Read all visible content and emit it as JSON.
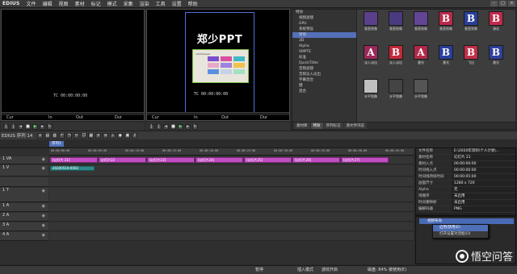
{
  "app": {
    "logo": "EDIUS"
  },
  "menu": [
    "文件",
    "编辑",
    "视图",
    "素材",
    "标记",
    "模式",
    "采集",
    "渲染",
    "工具",
    "设置",
    "帮助"
  ],
  "player": {
    "timecode": "TC 00:00:00:00",
    "cur_label": "Cur",
    "in_label": "In",
    "out_label": "Out",
    "dur_label": "Dur"
  },
  "recorder": {
    "timecode": "TC 00:00:00:00",
    "slide_title": "郑少PPT",
    "swatch_heading": "colorfulness",
    "swatch_colors": [
      "#7b4fd0",
      "#d94f9f",
      "#3fb8c7",
      "#e8a9c9",
      "#9d82e0",
      "#f0c24a",
      "#5b8fe2",
      "#c5d1e8",
      "#a4e0c2"
    ]
  },
  "bin": {
    "tree": [
      "特效",
      "视频滤镜",
      "GPU",
      "系统预设",
      "转场",
      "3D",
      "Alpha",
      "SMPTE",
      "标准",
      "QuickTitler",
      "音频滤镜",
      "音频淡入淡出",
      "字幕混合",
      "键",
      "混合"
    ],
    "tiles": [
      {
        "label": "垂直划像",
        "letter": "",
        "bg": "#5a3f8a"
      },
      {
        "label": "垂直划像",
        "letter": "",
        "bg": "#4a3a80"
      },
      {
        "label": "垂直划像",
        "letter": "",
        "bg": "#634595"
      },
      {
        "label": "垂直划像",
        "letter": "B",
        "bg": "#b82a4a"
      },
      {
        "label": "垂直划像",
        "letter": "B",
        "bg": "#2a3f9a"
      },
      {
        "label": "溶化",
        "letter": "B A",
        "bg": "#c02a4a"
      },
      {
        "label": "淡入淡出",
        "letter": "A",
        "bg": "#9a2a5a"
      },
      {
        "label": "淡入淡出",
        "letter": "B A",
        "bg": "#c02a3a"
      },
      {
        "label": "激光",
        "letter": "A",
        "bg": "#b02a4a"
      },
      {
        "label": "激光",
        "letter": "B",
        "bg": "#2a3f9a"
      },
      {
        "label": "飞出",
        "letter": "B A",
        "bg": "#c0304a"
      },
      {
        "label": "激光",
        "letter": "B",
        "bg": "#2f3f9a"
      },
      {
        "label": "水平划像",
        "letter": "",
        "bg": "#c0c0c0"
      },
      {
        "label": "水平划像",
        "letter": "",
        "bg": "#444"
      },
      {
        "label": "水平划像",
        "letter": "",
        "bg": "#555"
      }
    ],
    "tabs": [
      "素材库",
      "特效",
      "序列标记",
      "源文件浏览"
    ]
  },
  "timeline": {
    "title": "EDIUS 序列 14",
    "sequence_tab": "序列1",
    "ruler": [
      "00:00:00:00",
      "00:00:05:00",
      "00:00:10:00",
      "00:00:15:00",
      "00:00:20:00",
      "00:00:25:00",
      "00:00:30:00",
      "00:00:35:00",
      "00:00:40:00",
      "00:00:45:00"
    ],
    "tracks": [
      "1 VA",
      "1 V",
      "",
      "1 T",
      "1 A",
      "2 A",
      "3 A",
      "4 A"
    ],
    "clips": [
      "[幻灯片 21]",
      "幻灯片22",
      "[幻灯片23]",
      "[幻灯片24]",
      "[幻灯片25]",
      "[幻灯片26]",
      "[幻灯片27]"
    ],
    "title_clip": "20200510-0002"
  },
  "info": [
    {
      "key": "文件名称",
      "val": "E:\\2020年资料\\个人计划\\..."
    },
    {
      "key": "素材名称",
      "val": "幻灯片 21"
    },
    {
      "key": "素材入点",
      "val": "00:00:00:00"
    },
    {
      "key": "时间线入点",
      "val": "00:00:00:00"
    },
    {
      "key": "时间线持续时间",
      "val": "00:00:05:00"
    },
    {
      "key": "画面尺寸",
      "val": "1280 x 720"
    },
    {
      "key": "Alpha",
      "val": "无"
    },
    {
      "key": "场顺序",
      "val": "未启用"
    },
    {
      "key": "时间重映射",
      "val": "未启用"
    },
    {
      "key": "编解码器",
      "val": "PNG"
    }
  ],
  "layer": {
    "row_label": "视频布局",
    "menu": [
      "启用/禁用(E)",
      "打开设置对话框(O)",
      "",
      "",
      ""
    ]
  },
  "status": {
    "save": "暂停",
    "insert": "插入模式",
    "ripple": "波纹开启",
    "disk": "磁盘: 84% 被使用(E)"
  },
  "watermark": "悟空问答"
}
